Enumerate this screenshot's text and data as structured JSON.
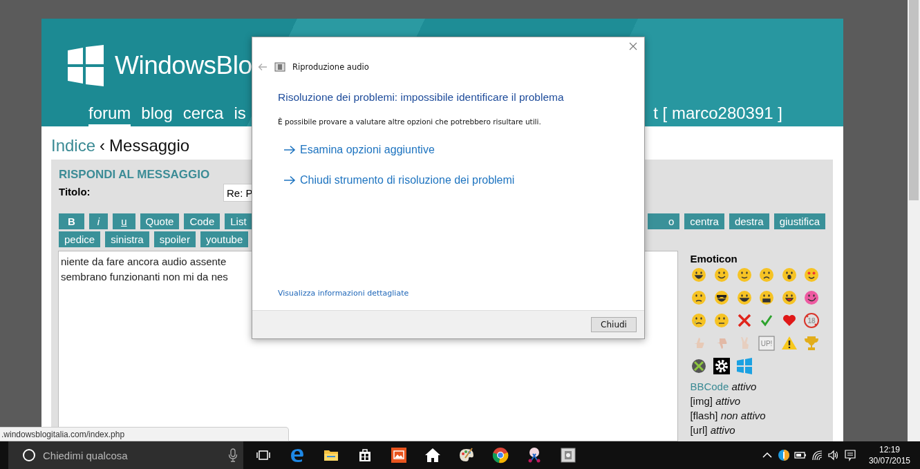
{
  "site": {
    "logo_text": "WindowsBlo",
    "nav": [
      {
        "label": "forum",
        "selected": true
      },
      {
        "label": "blog",
        "selected": false
      },
      {
        "label": "cerca",
        "selected": false
      },
      {
        "label": "is",
        "selected": false
      }
    ],
    "user_link": "t [ marco280391 ]"
  },
  "breadcrumb": {
    "link": "Indice",
    "separator": "‹",
    "current": "Messaggio"
  },
  "reply_form": {
    "title": "RISPONDI AL MESSAGGIO",
    "subject_label": "Titolo:",
    "subject_value": "Re: P",
    "toolbar_row_1_left": [
      {
        "label": "B",
        "kind": "bold"
      },
      {
        "label": "i",
        "kind": "italic"
      },
      {
        "label": "u",
        "kind": "underline"
      },
      {
        "label": "Quote",
        "kind": "plain"
      },
      {
        "label": "Code",
        "kind": "plain"
      },
      {
        "label": "List",
        "kind": "plain"
      }
    ],
    "toolbar_row_1_right": [
      {
        "label": "o",
        "kind": "plain"
      },
      {
        "label": "centra",
        "kind": "plain"
      },
      {
        "label": "destra",
        "kind": "plain"
      },
      {
        "label": "giustifica",
        "kind": "plain"
      }
    ],
    "toolbar_row_2": [
      {
        "label": "pedice",
        "kind": "plain"
      },
      {
        "label": "sinistra",
        "kind": "plain"
      },
      {
        "label": "spoiler",
        "kind": "plain"
      },
      {
        "label": "youtube",
        "kind": "plain"
      }
    ],
    "message_lines": [
      "niente da fare ancora audio assente",
      "sembrano funzionanti non mi da nes"
    ]
  },
  "sidebar": {
    "title": "Emoticon",
    "emoticons": [
      {
        "kind": "grin"
      },
      {
        "kind": "smile"
      },
      {
        "kind": "wink"
      },
      {
        "kind": "frown"
      },
      {
        "kind": "surprised"
      },
      {
        "kind": "love"
      },
      {
        "kind": "worried"
      },
      {
        "kind": "cool"
      },
      {
        "kind": "laugh"
      },
      {
        "kind": "angry"
      },
      {
        "kind": "tongue"
      },
      {
        "kind": "silly"
      },
      {
        "kind": "cry"
      },
      {
        "kind": "neutral"
      },
      {
        "kind": "cross"
      },
      {
        "kind": "check"
      },
      {
        "kind": "heart"
      },
      {
        "kind": "no-entry",
        "text": "18"
      },
      {
        "kind": "thumbs-up"
      },
      {
        "kind": "thumbs-down"
      },
      {
        "kind": "peace"
      },
      {
        "kind": "badge",
        "text": "UP!"
      },
      {
        "kind": "warning"
      },
      {
        "kind": "trophy"
      },
      {
        "kind": "x-ball"
      },
      {
        "kind": "gear"
      },
      {
        "kind": "panes"
      }
    ],
    "bbcode_status": [
      {
        "name": "BBCode",
        "state": "attivo",
        "kind": "link"
      },
      {
        "name": "[img]",
        "state": "attivo",
        "kind": "plain"
      },
      {
        "name": "[flash]",
        "state": "non attivo",
        "kind": "plain"
      },
      {
        "name": "[url]",
        "state": "attivo",
        "kind": "plain"
      }
    ]
  },
  "status_url": ".windowsblogitalia.com/index.php",
  "dialog": {
    "title": "Riproduzione audio",
    "heading": "Risoluzione dei problemi: impossibile identificare il problema",
    "message": "È possibile provare a valutare altre opzioni che potrebbero risultare utili.",
    "options": [
      "Esamina opzioni aggiuntive",
      "Chiudi strumento di risoluzione dei problemi"
    ],
    "details_link": "Visualizza informazioni dettagliate",
    "close_button": "Chiudi"
  },
  "taskbar": {
    "search_placeholder": "Chiedimi qualcosa",
    "time": "12:19",
    "date": "30/07/2015"
  }
}
